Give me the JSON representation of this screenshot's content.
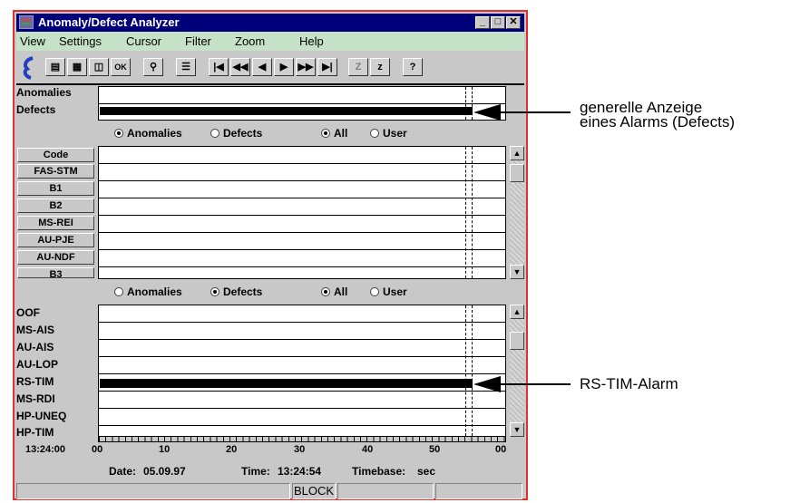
{
  "window": {
    "title": "Anomaly/Defect Analyzer"
  },
  "menu": [
    "View",
    "Settings",
    "Cursor",
    "Filter",
    "Zoom",
    "Help"
  ],
  "top_panel": {
    "labels": [
      "Anomalies",
      "Defects"
    ]
  },
  "filter1": {
    "opt_anomalies": "Anomalies",
    "opt_defects": "Defects",
    "opt_all": "All",
    "opt_user": "User",
    "selected_type": "Anomalies",
    "selected_scope": "All"
  },
  "anomaly_codes": [
    "Code",
    "FAS-STM",
    "B1",
    "B2",
    "MS-REI",
    "AU-PJE",
    "AU-NDF",
    "B3"
  ],
  "filter2": {
    "opt_anomalies": "Anomalies",
    "opt_defects": "Defects",
    "opt_all": "All",
    "opt_user": "User",
    "selected_type": "Defects",
    "selected_scope": "All"
  },
  "defect_codes": [
    "OOF",
    "MS-AIS",
    "AU-AIS",
    "AU-LOP",
    "RS-TIM",
    "MS-RDI",
    "HP-UNEQ",
    "HP-TIM"
  ],
  "time_axis": {
    "start_label": "13:24:00",
    "ticks": [
      "00",
      "10",
      "20",
      "30",
      "40",
      "50",
      "00"
    ]
  },
  "status": {
    "date_label": "Date:",
    "date": "05.09.97",
    "time_label": "Time:",
    "time": "13:24:54",
    "timebase_label": "Timebase:",
    "timebase": "sec",
    "mode": "BLOCK"
  },
  "annotations": {
    "top_line1": "generelle Anzeige",
    "top_line2": "eines Alarms (Defects)",
    "bottom": "RS-TIM-Alarm"
  }
}
